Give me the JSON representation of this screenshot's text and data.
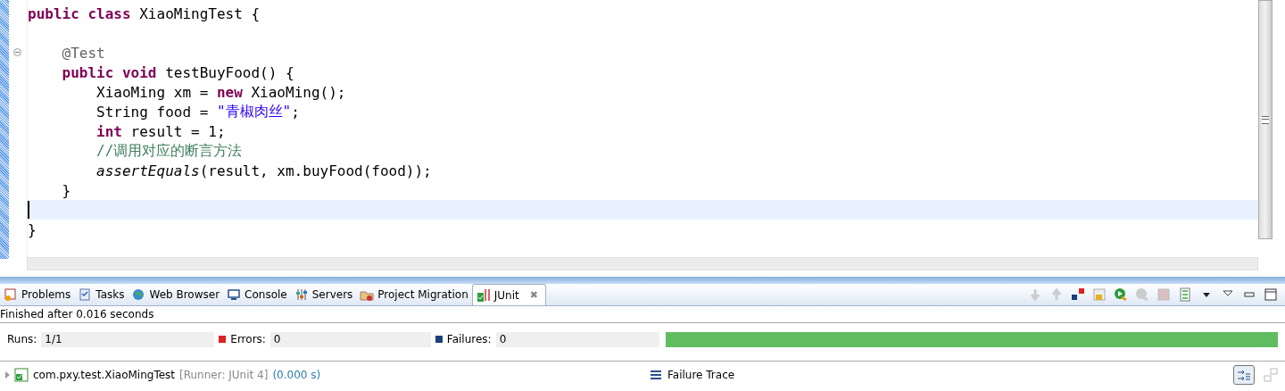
{
  "editor": {
    "lines": [
      {
        "kind": "code",
        "tokens": [
          {
            "kind": "keyword",
            "text": "public class"
          },
          {
            "kind": "plain",
            "text": " XiaoMingTest {"
          }
        ]
      },
      {
        "kind": "blank"
      },
      {
        "kind": "code",
        "fold": {
          "expanded": true
        },
        "tokens": [
          {
            "kind": "annotation",
            "text": "    @Test"
          }
        ]
      },
      {
        "kind": "code",
        "tokens": [
          {
            "kind": "keyword",
            "text": "    public void"
          },
          {
            "kind": "plain",
            "text": " testBuyFood() {"
          }
        ]
      },
      {
        "kind": "code",
        "tokens": [
          {
            "kind": "plain",
            "text": "        XiaoMing xm = "
          },
          {
            "kind": "keyword",
            "text": "new"
          },
          {
            "kind": "plain",
            "text": " XiaoMing();"
          }
        ]
      },
      {
        "kind": "code",
        "tokens": [
          {
            "kind": "plain",
            "text": "        String food = "
          },
          {
            "kind": "string",
            "text": "\"青椒肉丝\""
          },
          {
            "kind": "plain",
            "text": ";"
          }
        ]
      },
      {
        "kind": "code",
        "tokens": [
          {
            "kind": "keyword",
            "text": "        int"
          },
          {
            "kind": "plain",
            "text": " result = 1;"
          }
        ]
      },
      {
        "kind": "code",
        "tokens": [
          {
            "kind": "comment",
            "text": "        //调用对应的断言方法"
          }
        ]
      },
      {
        "kind": "code",
        "tokens": [
          {
            "kind": "static",
            "text": "        assertEquals"
          },
          {
            "kind": "plain",
            "text": "(result, xm.buyFood(food));"
          }
        ]
      },
      {
        "kind": "code",
        "tokens": [
          {
            "kind": "plain",
            "text": "    }"
          }
        ]
      },
      {
        "kind": "code",
        "current": true
      },
      {
        "kind": "code",
        "tokens": [
          {
            "kind": "plain",
            "text": "}"
          }
        ]
      }
    ]
  },
  "tabs": [
    {
      "label": "Problems",
      "selected": false
    },
    {
      "label": "Tasks",
      "selected": false
    },
    {
      "label": "Web Browser",
      "selected": false
    },
    {
      "label": "Console",
      "selected": false
    },
    {
      "label": "Servers",
      "selected": false
    },
    {
      "label": "Project Migration",
      "selected": false
    },
    {
      "label": "JUnit",
      "selected": true,
      "close": "✖"
    }
  ],
  "status": "Finished after 0.016 seconds",
  "counters": [
    {
      "kind": "runs",
      "label": "Runs:",
      "value": "1/1"
    },
    {
      "kind": "errors",
      "label": "Errors:",
      "value": "0"
    },
    {
      "kind": "failures",
      "label": "Failures:",
      "value": "0"
    }
  ],
  "progress": {
    "level": 1,
    "failed": false
  },
  "tests": [
    {
      "expanded": false,
      "name": "com.pxy.test.XiaoMingTest",
      "runner": "[Runner: JUnit 4]",
      "time": "(0.000 s)"
    }
  ],
  "failure_trace": {
    "title": "Failure Trace"
  }
}
